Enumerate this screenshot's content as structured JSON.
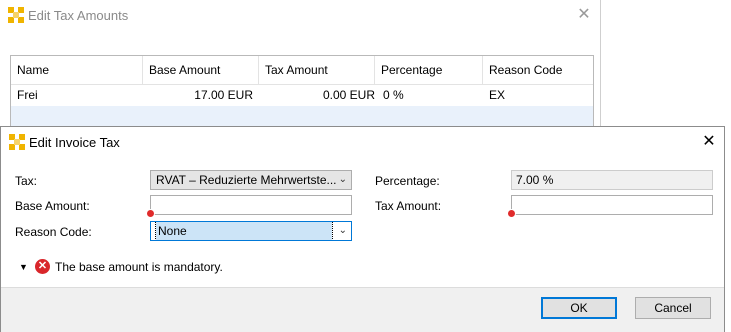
{
  "back_window": {
    "title": "Edit Tax Amounts",
    "close_glyph": "✕",
    "table": {
      "columns": [
        "Name",
        "Base Amount",
        "Tax Amount",
        "Percentage",
        "Reason Code"
      ],
      "rows": [
        [
          "Frei",
          "17.00 EUR",
          "0.00 EUR",
          "0 %",
          "EX"
        ]
      ]
    }
  },
  "dialog": {
    "title": "Edit Invoice Tax",
    "close_glyph": "✕",
    "tax_label": "Tax:",
    "tax_value": "RVAT – Reduzierte Mehrwertste...",
    "percentage_label": "Percentage:",
    "percentage_value": "7.00 %",
    "base_amount_label": "Base Amount:",
    "base_amount_value": "",
    "tax_amount_label": "Tax Amount:",
    "tax_amount_value": "",
    "reason_code_label": "Reason Code:",
    "reason_code_value": "None",
    "message": "The base amount is mandatory.",
    "ok_label": "OK",
    "cancel_label": "Cancel"
  },
  "icons": {
    "app": "app-logo-icon",
    "dropdown": "chevron-down-icon",
    "error": "error-icon",
    "collapse": "caret-down-icon"
  },
  "colors": {
    "accent": "#0078d7",
    "error": "#d9262b",
    "selection": "#cce4f7",
    "logo": "#f0b400"
  }
}
